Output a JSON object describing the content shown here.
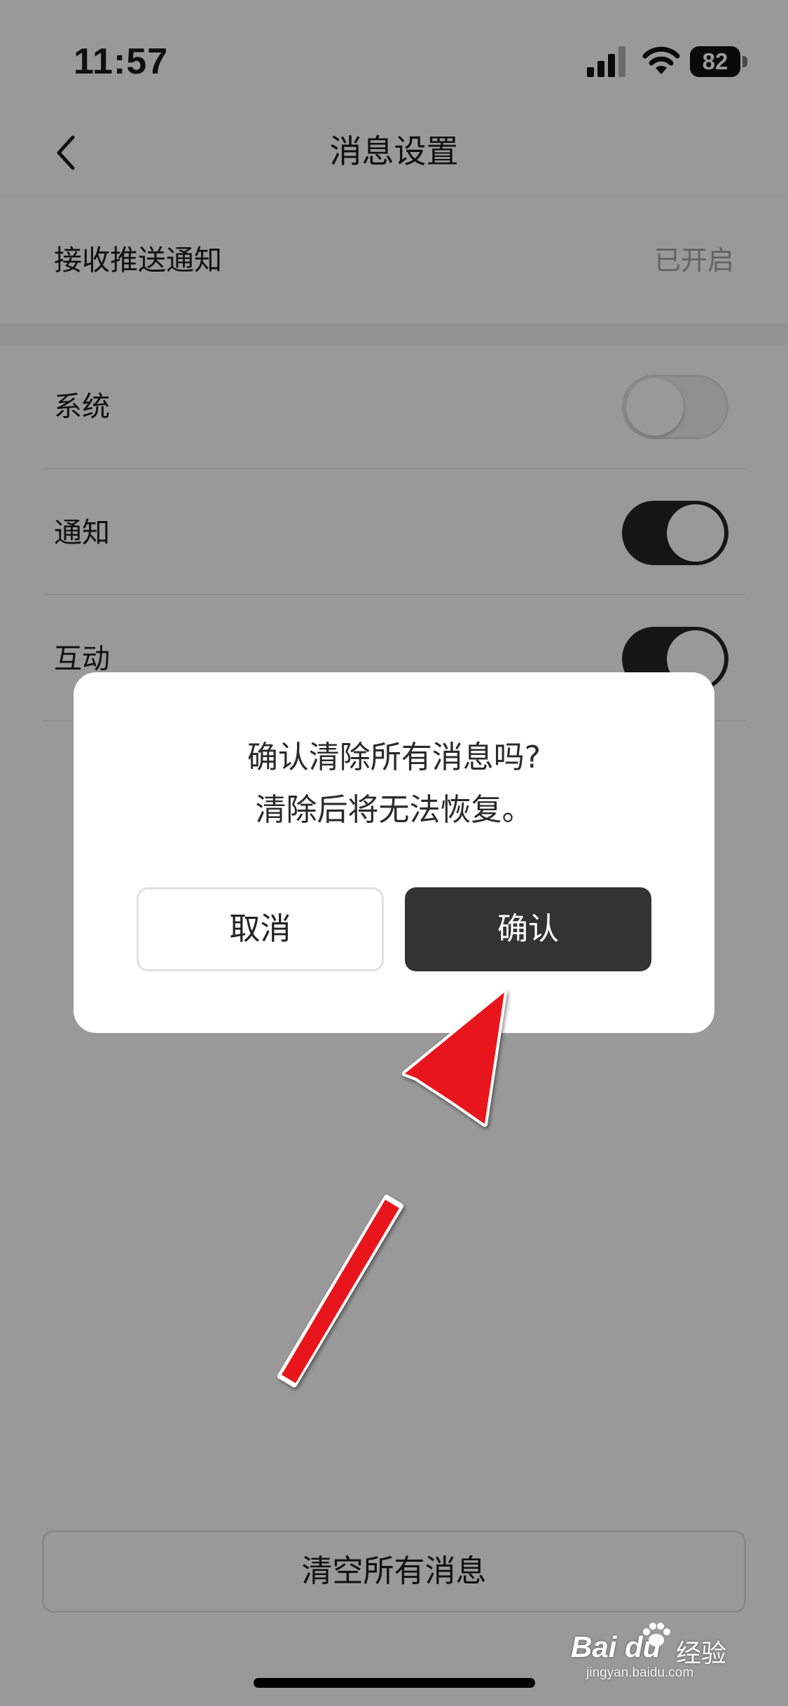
{
  "status_bar": {
    "time": "11:57",
    "battery_level": "82"
  },
  "nav": {
    "title": "消息设置"
  },
  "settings": {
    "push": {
      "label": "接收推送通知",
      "value": "已开启"
    },
    "toggles": [
      {
        "label": "系统",
        "on": false
      },
      {
        "label": "通知",
        "on": true
      },
      {
        "label": "互动",
        "on": true
      }
    ]
  },
  "clear_button_label": "清空所有消息",
  "dialog": {
    "line1": "确认清除所有消息吗?",
    "line2": "清除后将无法恢复。",
    "cancel_label": "取消",
    "confirm_label": "确认"
  },
  "watermark": {
    "brand": "Bai du",
    "jingyan": "经验",
    "url": "jingyan.baidu.com"
  },
  "colors": {
    "annotation_arrow": "#e8141c",
    "primary_button": "#333333",
    "toggle_on": "#262626"
  }
}
